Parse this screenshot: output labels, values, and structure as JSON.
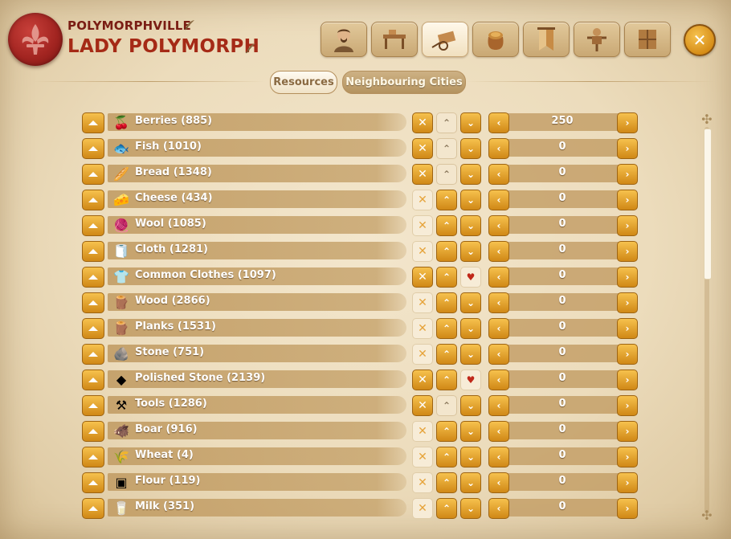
{
  "header": {
    "city_name": "POLYMORPHVILLE",
    "player_name": "LADY POLYMORPH"
  },
  "nav_tabs": [
    {
      "icon": "governor-portrait-icon",
      "active": false
    },
    {
      "icon": "workshop-icon",
      "active": false
    },
    {
      "icon": "trade-cart-icon",
      "active": true
    },
    {
      "icon": "grain-sack-icon",
      "active": false
    },
    {
      "icon": "banner-icon",
      "active": false
    },
    {
      "icon": "scarecrow-icon",
      "active": false
    },
    {
      "icon": "map-scroll-icon",
      "active": false
    }
  ],
  "close_icon": "close-icon",
  "sub_tabs": {
    "resources": "Resources",
    "neighbouring_cities": "Neighbouring Cities"
  },
  "resources": [
    {
      "label": "Berries (885)",
      "icon": "berries-icon",
      "value": "250",
      "x_state": "active",
      "up_state": "off",
      "down_state": "active"
    },
    {
      "label": "Fish (1010)",
      "icon": "fish-icon",
      "value": "0",
      "x_state": "active",
      "up_state": "off",
      "down_state": "active"
    },
    {
      "label": "Bread (1348)",
      "icon": "bread-icon",
      "value": "0",
      "x_state": "active",
      "up_state": "off",
      "down_state": "active"
    },
    {
      "label": "Cheese (434)",
      "icon": "cheese-icon",
      "value": "0",
      "x_state": "off",
      "up_state": "active",
      "down_state": "active"
    },
    {
      "label": "Wool (1085)",
      "icon": "wool-icon",
      "value": "0",
      "x_state": "off",
      "up_state": "active",
      "down_state": "active"
    },
    {
      "label": "Cloth (1281)",
      "icon": "cloth-icon",
      "value": "0",
      "x_state": "off",
      "up_state": "active",
      "down_state": "active"
    },
    {
      "label": "Common Clothes (1097)",
      "icon": "clothes-icon",
      "value": "0",
      "x_state": "active",
      "up_state": "active",
      "down_state": "heart"
    },
    {
      "label": "Wood (2866)",
      "icon": "wood-icon",
      "value": "0",
      "x_state": "off",
      "up_state": "active",
      "down_state": "active"
    },
    {
      "label": "Planks (1531)",
      "icon": "planks-icon",
      "value": "0",
      "x_state": "off",
      "up_state": "active",
      "down_state": "active"
    },
    {
      "label": "Stone (751)",
      "icon": "stone-icon",
      "value": "0",
      "x_state": "off",
      "up_state": "active",
      "down_state": "active"
    },
    {
      "label": "Polished Stone (2139)",
      "icon": "polished-stone-icon",
      "value": "0",
      "x_state": "active",
      "up_state": "active",
      "down_state": "heart"
    },
    {
      "label": "Tools (1286)",
      "icon": "tools-icon",
      "value": "0",
      "x_state": "active",
      "up_state": "off",
      "down_state": "active"
    },
    {
      "label": "Boar (916)",
      "icon": "boar-icon",
      "value": "0",
      "x_state": "off",
      "up_state": "active",
      "down_state": "active"
    },
    {
      "label": "Wheat (4)",
      "icon": "wheat-icon",
      "value": "0",
      "x_state": "off",
      "up_state": "active",
      "down_state": "active"
    },
    {
      "label": "Flour (119)",
      "icon": "flour-icon",
      "value": "0",
      "x_state": "off",
      "up_state": "active",
      "down_state": "active"
    },
    {
      "label": "Milk (351)",
      "icon": "milk-icon",
      "value": "0",
      "x_state": "off",
      "up_state": "active",
      "down_state": "active"
    }
  ],
  "scrollbar_position": 0
}
